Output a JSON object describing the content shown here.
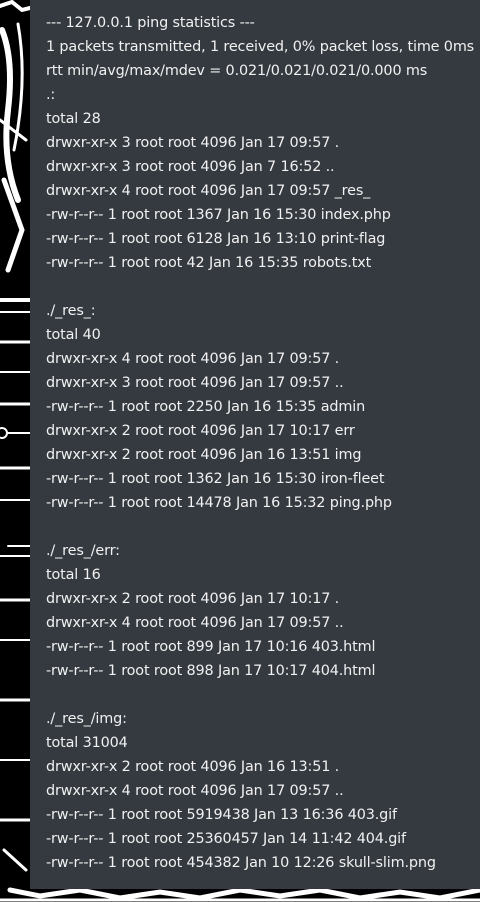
{
  "colors": {
    "panel_background": "#353a41",
    "text": "#f1f1f1",
    "page_background": "#000000",
    "artwork_lines": "#ffffff"
  },
  "background": {
    "artwork_icon": "skull-artwork-background"
  },
  "terminal": {
    "lines": [
      "--- 127.0.0.1 ping statistics ---",
      "1 packets transmitted, 1 received, 0% packet loss, time 0ms",
      "rtt min/avg/max/mdev = 0.021/0.021/0.021/0.000 ms",
      ".:",
      "total 28",
      "drwxr-xr-x 3 root root 4096 Jan 17 09:57 .",
      "drwxr-xr-x 3 root root 4096 Jan 7 16:52 ..",
      "drwxr-xr-x 4 root root 4096 Jan 17 09:57 _res_",
      "-rw-r--r-- 1 root root 1367 Jan 16 15:30 index.php",
      "-rw-r--r-- 1 root root 6128 Jan 16 13:10 print-flag",
      "-rw-r--r-- 1 root root 42 Jan 16 15:35 robots.txt",
      "",
      "./_res_:",
      "total 40",
      "drwxr-xr-x 4 root root 4096 Jan 17 09:57 .",
      "drwxr-xr-x 3 root root 4096 Jan 17 09:57 ..",
      "-rw-r--r-- 1 root root 2250 Jan 16 15:35 admin",
      "drwxr-xr-x 2 root root 4096 Jan 17 10:17 err",
      "drwxr-xr-x 2 root root 4096 Jan 16 13:51 img",
      "-rw-r--r-- 1 root root 1362 Jan 16 15:30 iron-fleet",
      "-rw-r--r-- 1 root root 14478 Jan 16 15:32 ping.php",
      "",
      "./_res_/err:",
      "total 16",
      "drwxr-xr-x 2 root root 4096 Jan 17 10:17 .",
      "drwxr-xr-x 4 root root 4096 Jan 17 09:57 ..",
      "-rw-r--r-- 1 root root 899 Jan 17 10:16 403.html",
      "-rw-r--r-- 1 root root 898 Jan 17 10:17 404.html",
      "",
      "./_res_/img:",
      "total 31004",
      "drwxr-xr-x 2 root root 4096 Jan 16 13:51 .",
      "drwxr-xr-x 4 root root 4096 Jan 17 09:57 ..",
      "-rw-r--r-- 1 root root 5919438 Jan 13 16:36 403.gif",
      "-rw-r--r-- 1 root root 25360457 Jan 14 11:42 404.gif",
      "-rw-r--r-- 1 root root 454382 Jan 10 12:26 skull-slim.png"
    ]
  }
}
